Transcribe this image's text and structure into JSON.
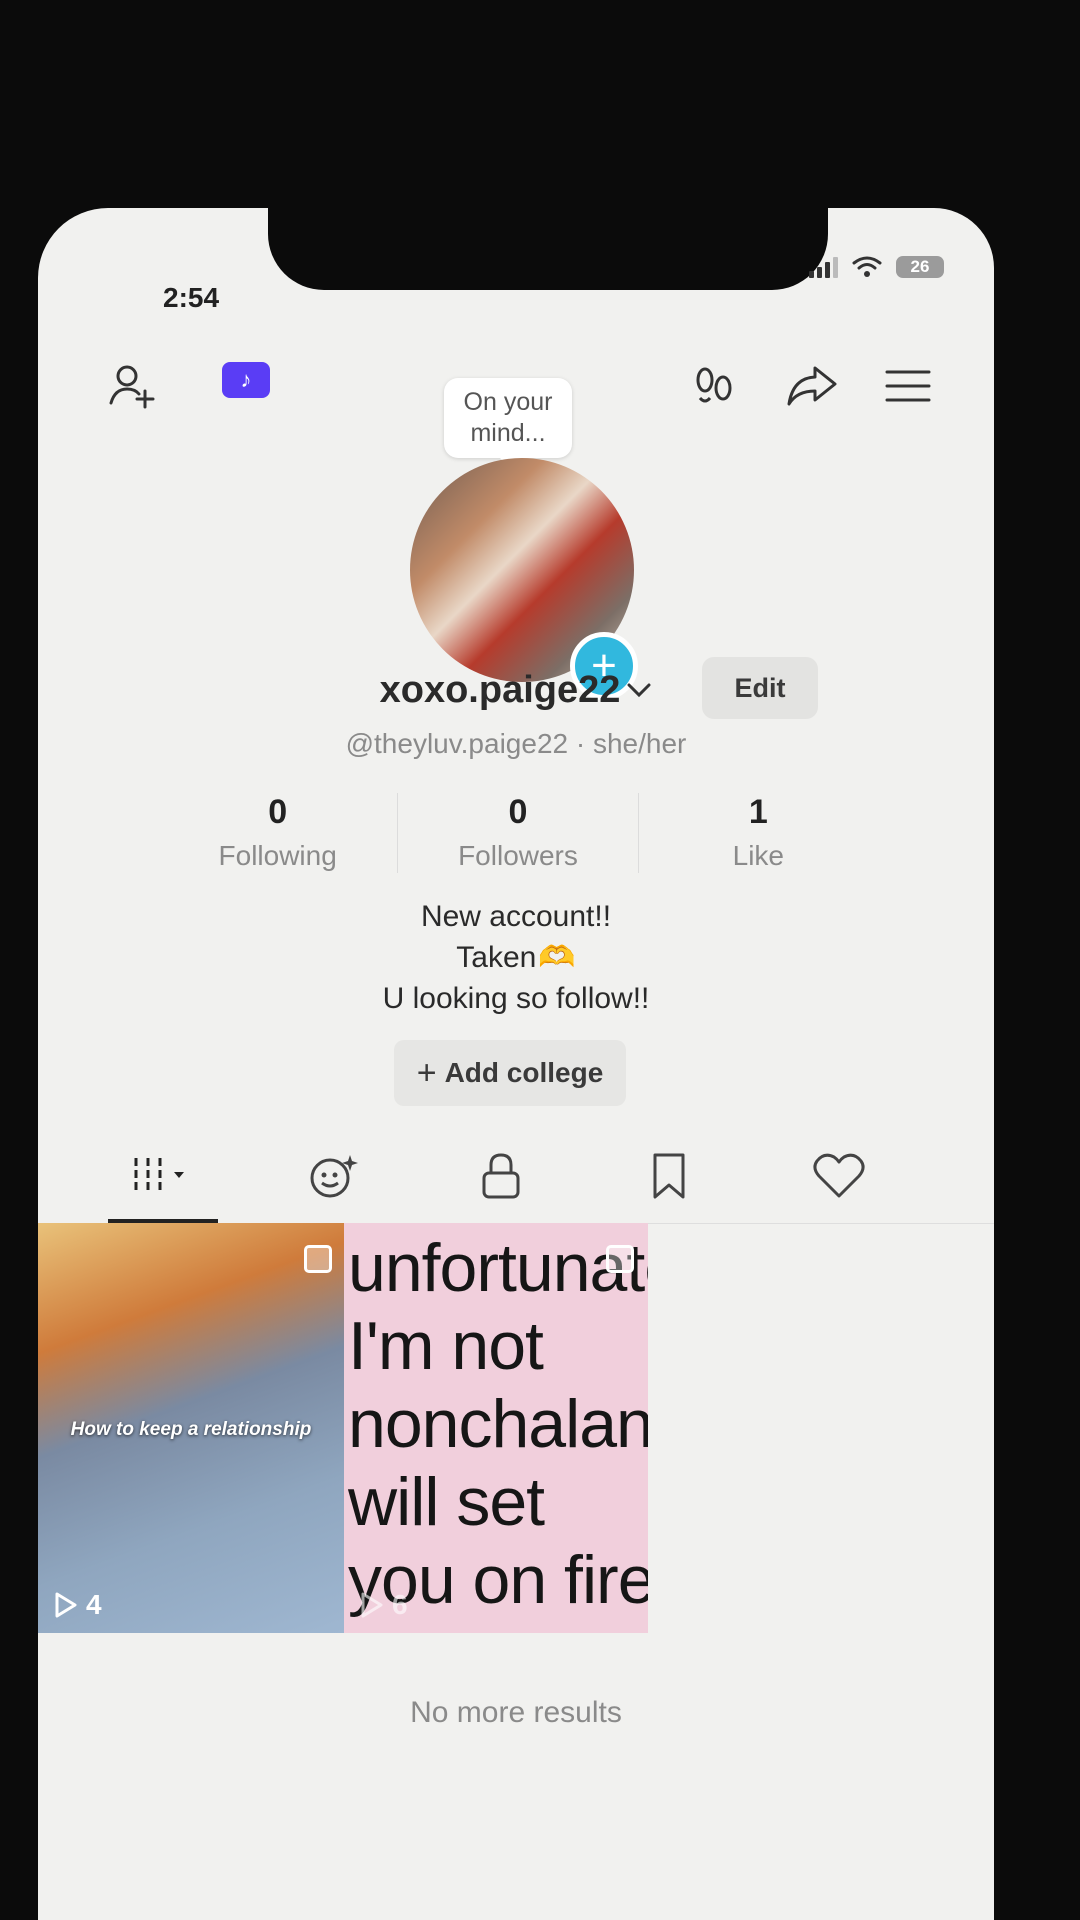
{
  "status_bar": {
    "time": "2:54",
    "battery": "26"
  },
  "profile": {
    "mind_bubble": "On your mind...",
    "display_name": "xoxo.paige22",
    "edit_label": "Edit",
    "handle": "@theyluv.paige22",
    "pronouns": "she/her",
    "stats": [
      {
        "value": "0",
        "label": "Following"
      },
      {
        "value": "0",
        "label": "Followers"
      },
      {
        "value": "1",
        "label": "Like"
      }
    ],
    "bio": {
      "line1": "New account!!",
      "line2": "Taken",
      "line2_emoji": "🫶",
      "line3": "U looking so follow!!"
    },
    "add_college_label": "Add college"
  },
  "tabs": [
    "videos-tab",
    "reposts-tab",
    "private-tab",
    "favorites-tab",
    "liked-tab"
  ],
  "videos": [
    {
      "caption": "How to keep a relationship",
      "views": "4"
    },
    {
      "overlay_text": "unfortunately\nI'm not\nnonchalant,\nwill set\nyou on fire",
      "views": "6"
    }
  ],
  "footer": {
    "no_more": "No more results"
  },
  "colors": {
    "accent_blue": "#31b8de",
    "tiktok_purple": "#5a3df5"
  }
}
